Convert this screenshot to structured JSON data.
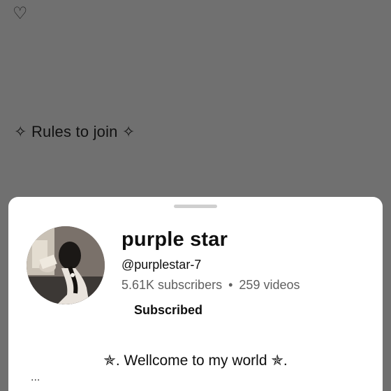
{
  "background": {
    "heart_glyph": "♡",
    "rules_heading": "✧ Rules to join ✧"
  },
  "channel": {
    "name": "purple star",
    "handle": "@purplestar-7",
    "subscribers": "5.61K subscribers",
    "separator": "•",
    "videos": "259 videos",
    "subscribe_state": "Subscribed",
    "description": "✯. Wellcome to my world ✯.",
    "more_indicator": "..."
  },
  "colors": {
    "scrim": "#707070",
    "sheet": "#ffffff",
    "primary_text": "#0f0f0f",
    "secondary_text": "#606060"
  }
}
